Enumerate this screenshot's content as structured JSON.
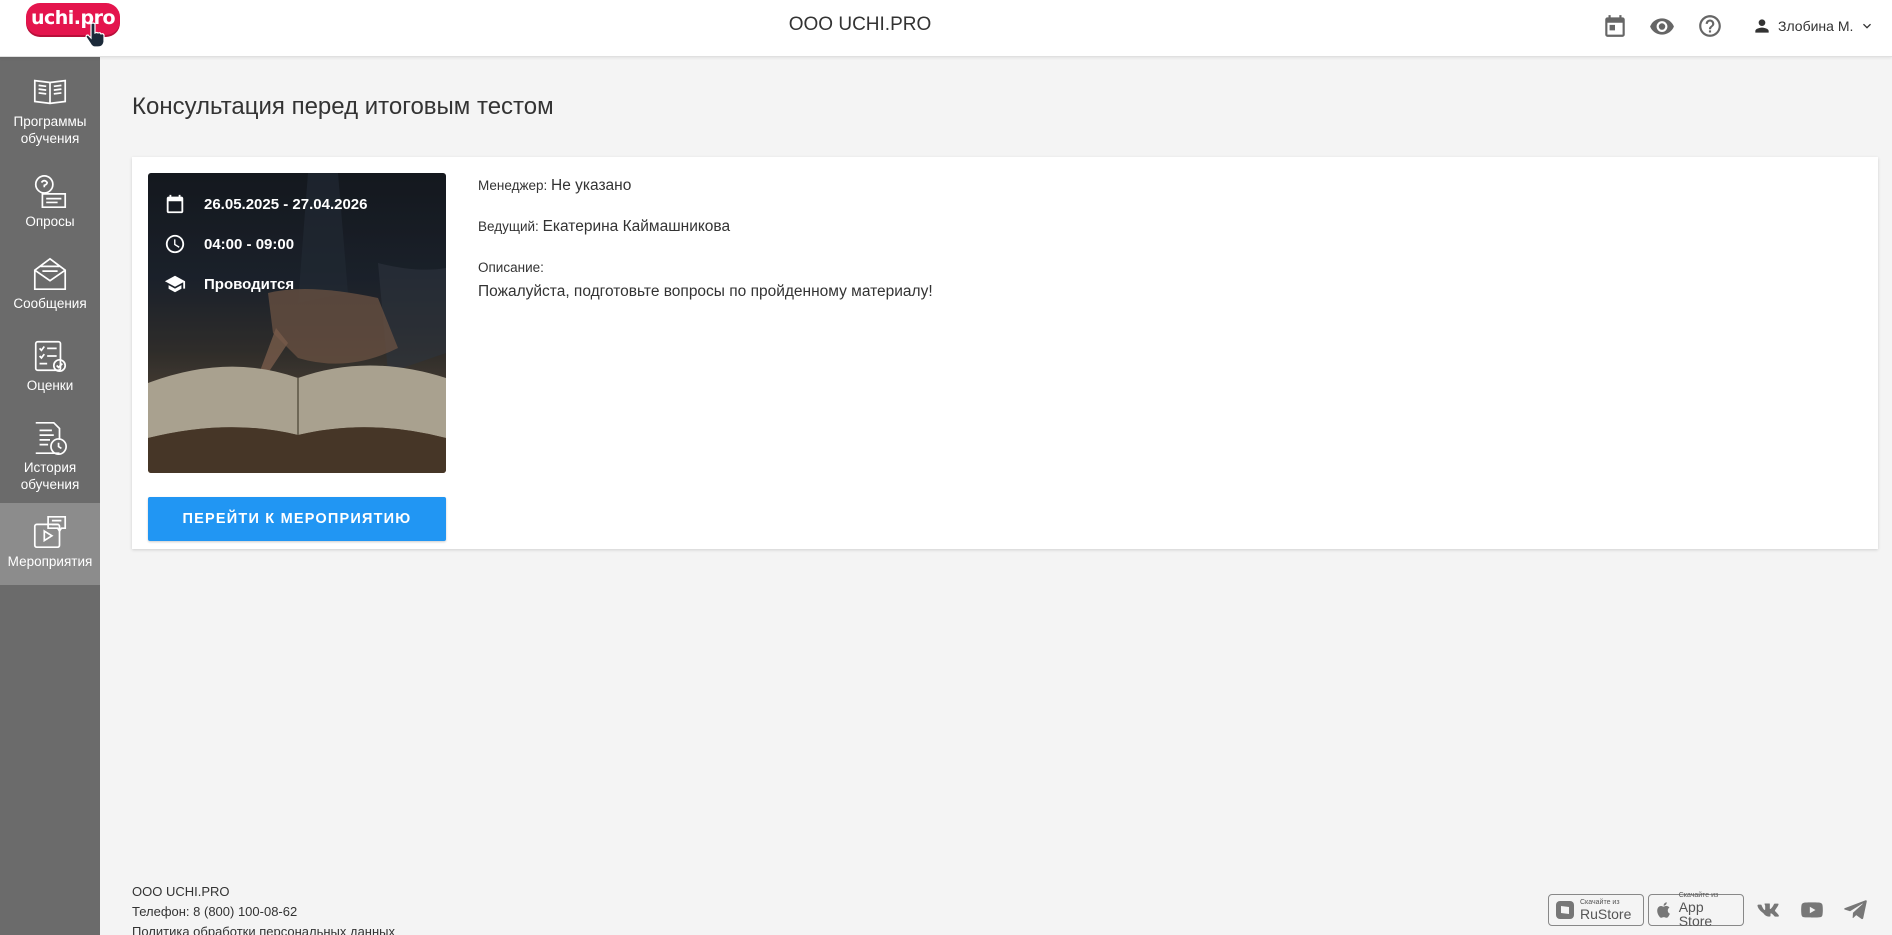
{
  "header": {
    "logo_text": "uchi.pro",
    "org_title": "ООО UCHI.PRO",
    "icons": [
      "calendar-icon",
      "eye-icon",
      "help-icon"
    ],
    "user_name": "Злобина М."
  },
  "sidebar": {
    "items": [
      {
        "label": "Программы обучения",
        "icon": "book-icon"
      },
      {
        "label": "Опросы",
        "icon": "survey-icon"
      },
      {
        "label": "Сообщения",
        "icon": "envelope-icon"
      },
      {
        "label": "Оценки",
        "icon": "grades-icon"
      },
      {
        "label": "История обучения",
        "icon": "history-icon"
      },
      {
        "label": "Мероприятия",
        "icon": "events-icon",
        "active": true
      }
    ]
  },
  "main": {
    "title": "Консультация перед итоговым тестом",
    "event": {
      "dates": "26.05.2025 - 27.04.2026",
      "time": "04:00 - 09:00",
      "status": "Проводится",
      "button_label": "ПЕРЕЙТИ К МЕРОПРИЯТИЮ"
    },
    "details": {
      "manager_label": "Менеджер:",
      "manager_value": "Не указано",
      "host_label": "Ведущий:",
      "host_value": "Екатерина Каймашникова",
      "description_label": "Описание:",
      "description_value": "Пожалуйста, подготовьте вопросы по пройденному материалу!"
    }
  },
  "footer": {
    "company": "ООО UCHI.PRO",
    "phone": "Телефон: 8 (800) 100-08-62",
    "policy": "Политика обработки персональных данных",
    "rustore_small": "Скачайте из",
    "rustore_big": "RuStore",
    "appstore_small": "Скачайте из",
    "appstore_big": "App Store",
    "social_icons": [
      "vk-icon",
      "youtube-icon",
      "telegram-icon"
    ]
  },
  "colors": {
    "accent": "#2196f3",
    "logo": "#e4154d",
    "sidebar": "#6b6b6b",
    "sidebar_active": "#8c8c8c"
  }
}
